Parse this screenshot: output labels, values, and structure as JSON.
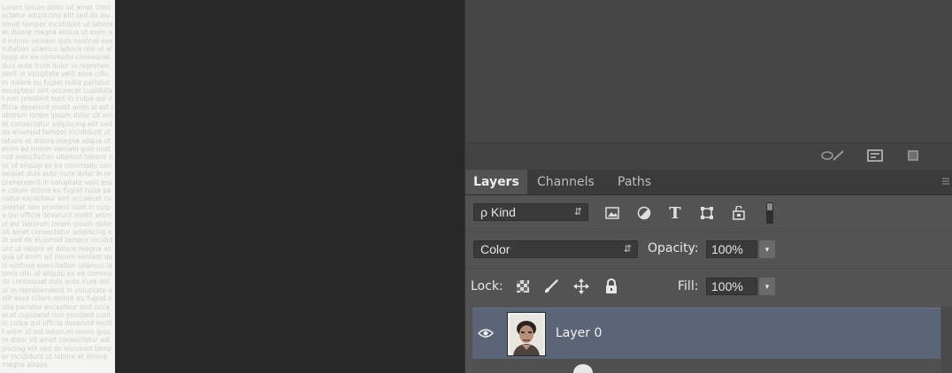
{
  "document_preview": {
    "text": "Lorem ipsum dolor sit amet consectetur adipiscing elit sed do eiusmod tempor incididunt ut labore et dolore magna aliqua ut enim ad minim veniam quis nostrud exercitation ullamco laboris nisi ut aliquip ex ea commodo consequat duis aute irure dolor in reprehenderit in voluptate velit esse cillum dolore eu fugiat nulla pariatur excepteur sint occaecat cupidatat non proident sunt in culpa qui officia deserunt mollit anim id est laborum lorem ipsum dolor sit amet consectetur adipiscing elit sed do eiusmod tempor incididunt ut labore et dolore magna aliqua ut enim ad minim veniam quis nostrud exercitation ullamco laboris nisi ut aliquip ex ea commodo consequat duis aute irure dolor in reprehenderit in voluptate velit esse cillum dolore eu fugiat nulla pariatur excepteur sint occaecat cupidatat non proident sunt in culpa qui officia deserunt mollit anim id est laborum lorem ipsum dolor sit amet consectetur adipiscing elit sed do eiusmod tempor incididunt ut labore et dolore magna aliqua ut enim ad minim veniam quis nostrud exercitation ullamco laboris nisi ut aliquip ex ea commodo consequat duis aute irure dolor in reprehenderit in voluptate velit esse cillum dolore eu fugiat nulla pariatur excepteur sint occaecat cupidatat non proident sunt in culpa qui officia deserunt mollit anim id est laborum lorem ipsum dolor sit amet consectetur adipiscing elit sed do eiusmod tempor incididunt ut labore et dolore magna aliqua"
  },
  "upper_panel_footer": {
    "icons": [
      "brush-preset-icon",
      "panel-options-icon",
      "new-item-icon"
    ]
  },
  "layers_panel": {
    "tabs": [
      {
        "label": "Layers",
        "active": true
      },
      {
        "label": "Channels",
        "active": false
      },
      {
        "label": "Paths",
        "active": false
      }
    ],
    "filter": {
      "kind_label": "ρ Kind",
      "icons": [
        "pixel-filter-icon",
        "adjustment-filter-icon",
        "type-filter-icon",
        "shape-filter-icon",
        "smart-object-filter-icon",
        "filter-toggle-icon"
      ]
    },
    "blend_mode": "Color",
    "opacity": {
      "label": "Opacity:",
      "value": "100%"
    },
    "lock": {
      "label": "Lock:",
      "icons": [
        "lock-transparent-icon",
        "lock-pixels-icon",
        "lock-position-icon",
        "lock-all-icon"
      ]
    },
    "fill": {
      "label": "Fill:",
      "value": "100%"
    },
    "layers": [
      {
        "name": "Layer 0",
        "visible": true,
        "selected": true
      }
    ],
    "colors": {
      "selected_row": "#5c6477",
      "panel_bg": "#535353",
      "tabbar_bg": "#3b3b3b"
    }
  }
}
